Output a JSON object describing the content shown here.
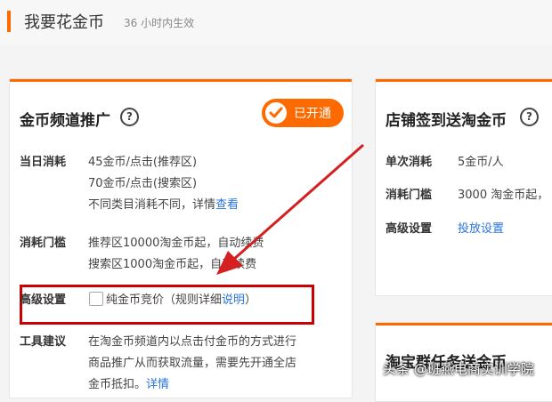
{
  "header": {
    "title": "我要花金币",
    "subtitle": "36 小时内生效"
  },
  "left_card": {
    "title": "金币频道推广",
    "status_label": "已开通",
    "rows": {
      "daily_cost": {
        "label": "当日消耗",
        "lines": [
          "45金币/点击(推荐区)",
          "70金币/点击(搜索区)"
        ],
        "note": "不同类目消耗不同，详情",
        "note_link": "查看"
      },
      "threshold": {
        "label": "消耗门槛",
        "lines": [
          "推荐区10000淘金币起，自动续费",
          "搜索区1000淘金币起，自动续费"
        ]
      },
      "advanced": {
        "label": "高级设置",
        "checkbox_label": "纯金币竞价（规则详细",
        "checkbox_link": "说明",
        "checkbox_suffix": "）"
      },
      "tool_tip": {
        "label": "工具建议",
        "lines": [
          "在淘金币频道内以点击付金币的方式进行",
          "商品推广从而获取流量，需要先开通全店"
        ],
        "last_line": "金币抵扣。",
        "last_link": "详情"
      }
    }
  },
  "right_card": {
    "title": "店铺签到送淘金币",
    "rows": {
      "single_cost": {
        "label": "单次消耗",
        "value": "5金币/人"
      },
      "threshold": {
        "label": "消耗门槛",
        "value": "3000 淘金币起，"
      },
      "advanced": {
        "label": "高级设置",
        "link": "投放设置"
      }
    }
  },
  "right_card2": {
    "title": "淘宝群任务送金币"
  },
  "watermark": "头条 @班燕电商实训学院",
  "colors": {
    "accent": "#ff6a00",
    "link": "#2b74d9",
    "highlight": "#cc0000"
  }
}
